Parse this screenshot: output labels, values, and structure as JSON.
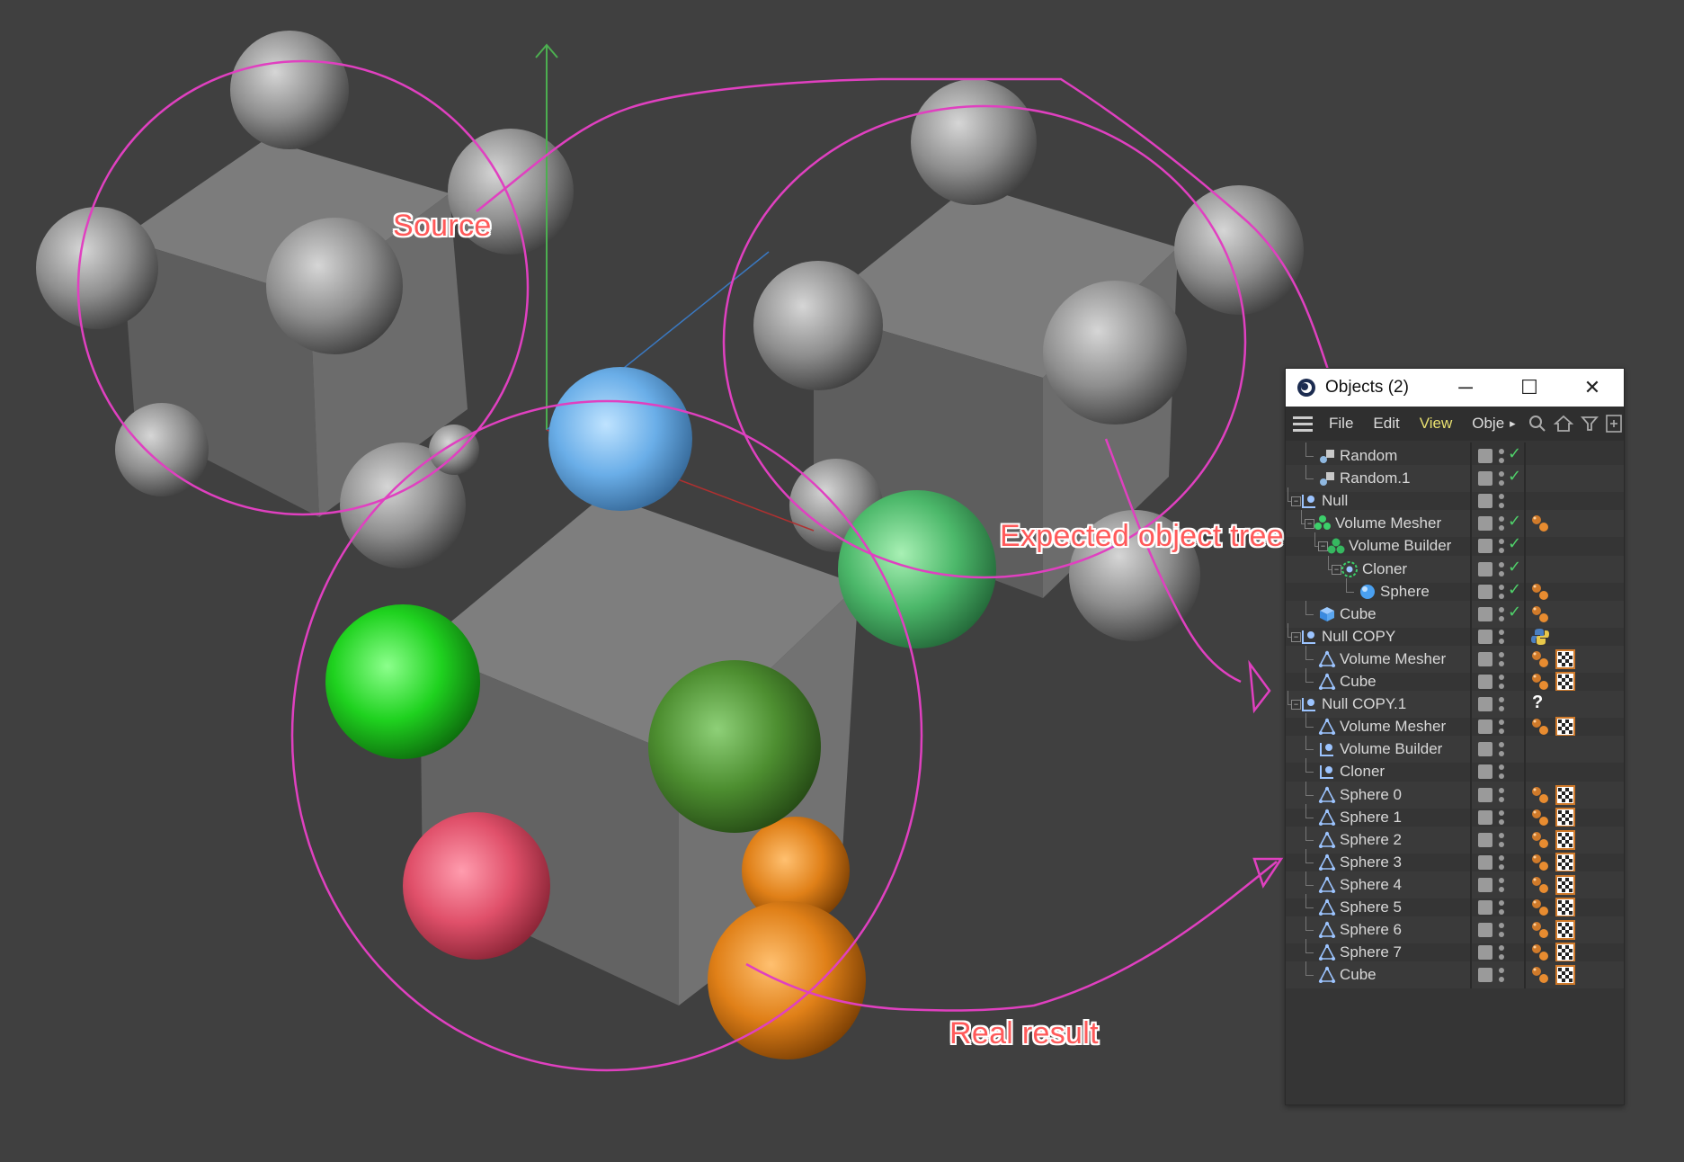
{
  "annotations": {
    "source": "Source",
    "expected": "Expected object tree",
    "real": "Real result"
  },
  "window": {
    "title": "Objects (2)",
    "minimize_glyph": "─",
    "maximize_glyph": "☐",
    "close_glyph": "✕"
  },
  "menu": {
    "file": "File",
    "edit": "Edit",
    "view": "View",
    "objects": "Obje",
    "more_glyph": "▸"
  },
  "tree": [
    {
      "name": "Random",
      "icon": "random-effector-icon",
      "check": true,
      "tags": []
    },
    {
      "name": "Random.1",
      "icon": "random-effector-icon",
      "check": true,
      "tags": []
    },
    {
      "name": "Null",
      "icon": "null-icon",
      "check": false,
      "tags": []
    },
    {
      "name": "Volume Mesher",
      "icon": "volume-mesher-icon",
      "check": true,
      "tags": [
        "material-tag"
      ]
    },
    {
      "name": "Volume Builder",
      "icon": "volume-builder-icon",
      "check": true,
      "tags": []
    },
    {
      "name": "Cloner",
      "icon": "cloner-icon",
      "check": true,
      "tags": []
    },
    {
      "name": "Sphere",
      "icon": "sphere-icon",
      "check": true,
      "tags": [
        "material-tag"
      ]
    },
    {
      "name": "Cube",
      "icon": "cube-icon",
      "check": true,
      "tags": [
        "material-tag"
      ]
    },
    {
      "name": "Null COPY",
      "icon": "null-icon",
      "check": false,
      "tags": [
        "python-tag"
      ]
    },
    {
      "name": "Volume Mesher",
      "icon": "polygon-icon",
      "check": false,
      "tags": [
        "material-tag",
        "checker-tag"
      ]
    },
    {
      "name": "Cube",
      "icon": "polygon-icon",
      "check": false,
      "tags": [
        "material-tag",
        "checker-tag"
      ]
    },
    {
      "name": "Null COPY.1",
      "icon": "null-icon",
      "check": false,
      "tags": [
        "unknown-tag"
      ]
    },
    {
      "name": "Volume Mesher",
      "icon": "polygon-icon",
      "check": false,
      "tags": [
        "material-tag",
        "checker-tag"
      ]
    },
    {
      "name": "Volume Builder",
      "icon": "null-icon",
      "check": false,
      "tags": []
    },
    {
      "name": "Cloner",
      "icon": "null-icon",
      "check": false,
      "tags": []
    },
    {
      "name": "Sphere 0",
      "icon": "polygon-icon",
      "check": false,
      "tags": [
        "material-tag",
        "checker-tag"
      ]
    },
    {
      "name": "Sphere 1",
      "icon": "polygon-icon",
      "check": false,
      "tags": [
        "material-tag",
        "checker-tag"
      ]
    },
    {
      "name": "Sphere 2",
      "icon": "polygon-icon",
      "check": false,
      "tags": [
        "material-tag",
        "checker-tag"
      ]
    },
    {
      "name": "Sphere 3",
      "icon": "polygon-icon",
      "check": false,
      "tags": [
        "material-tag",
        "checker-tag"
      ]
    },
    {
      "name": "Sphere 4",
      "icon": "polygon-icon",
      "check": false,
      "tags": [
        "material-tag",
        "checker-tag"
      ]
    },
    {
      "name": "Sphere 5",
      "icon": "polygon-icon",
      "check": false,
      "tags": [
        "material-tag",
        "checker-tag"
      ]
    },
    {
      "name": "Sphere 6",
      "icon": "polygon-icon",
      "check": false,
      "tags": [
        "material-tag",
        "checker-tag"
      ]
    },
    {
      "name": "Sphere 7",
      "icon": "polygon-icon",
      "check": false,
      "tags": [
        "material-tag",
        "checker-tag"
      ]
    },
    {
      "name": "Cube",
      "icon": "polygon-icon",
      "check": false,
      "tags": [
        "material-tag",
        "checker-tag"
      ]
    }
  ],
  "unknown_tag_glyph": "?",
  "check_glyph": "✓",
  "colors": {
    "annotation_stroke": "#e040c0",
    "annotation_text": "#ff5a5a",
    "background": "#404040",
    "check": "#4fd06a",
    "view_menu": "#e8e070"
  }
}
